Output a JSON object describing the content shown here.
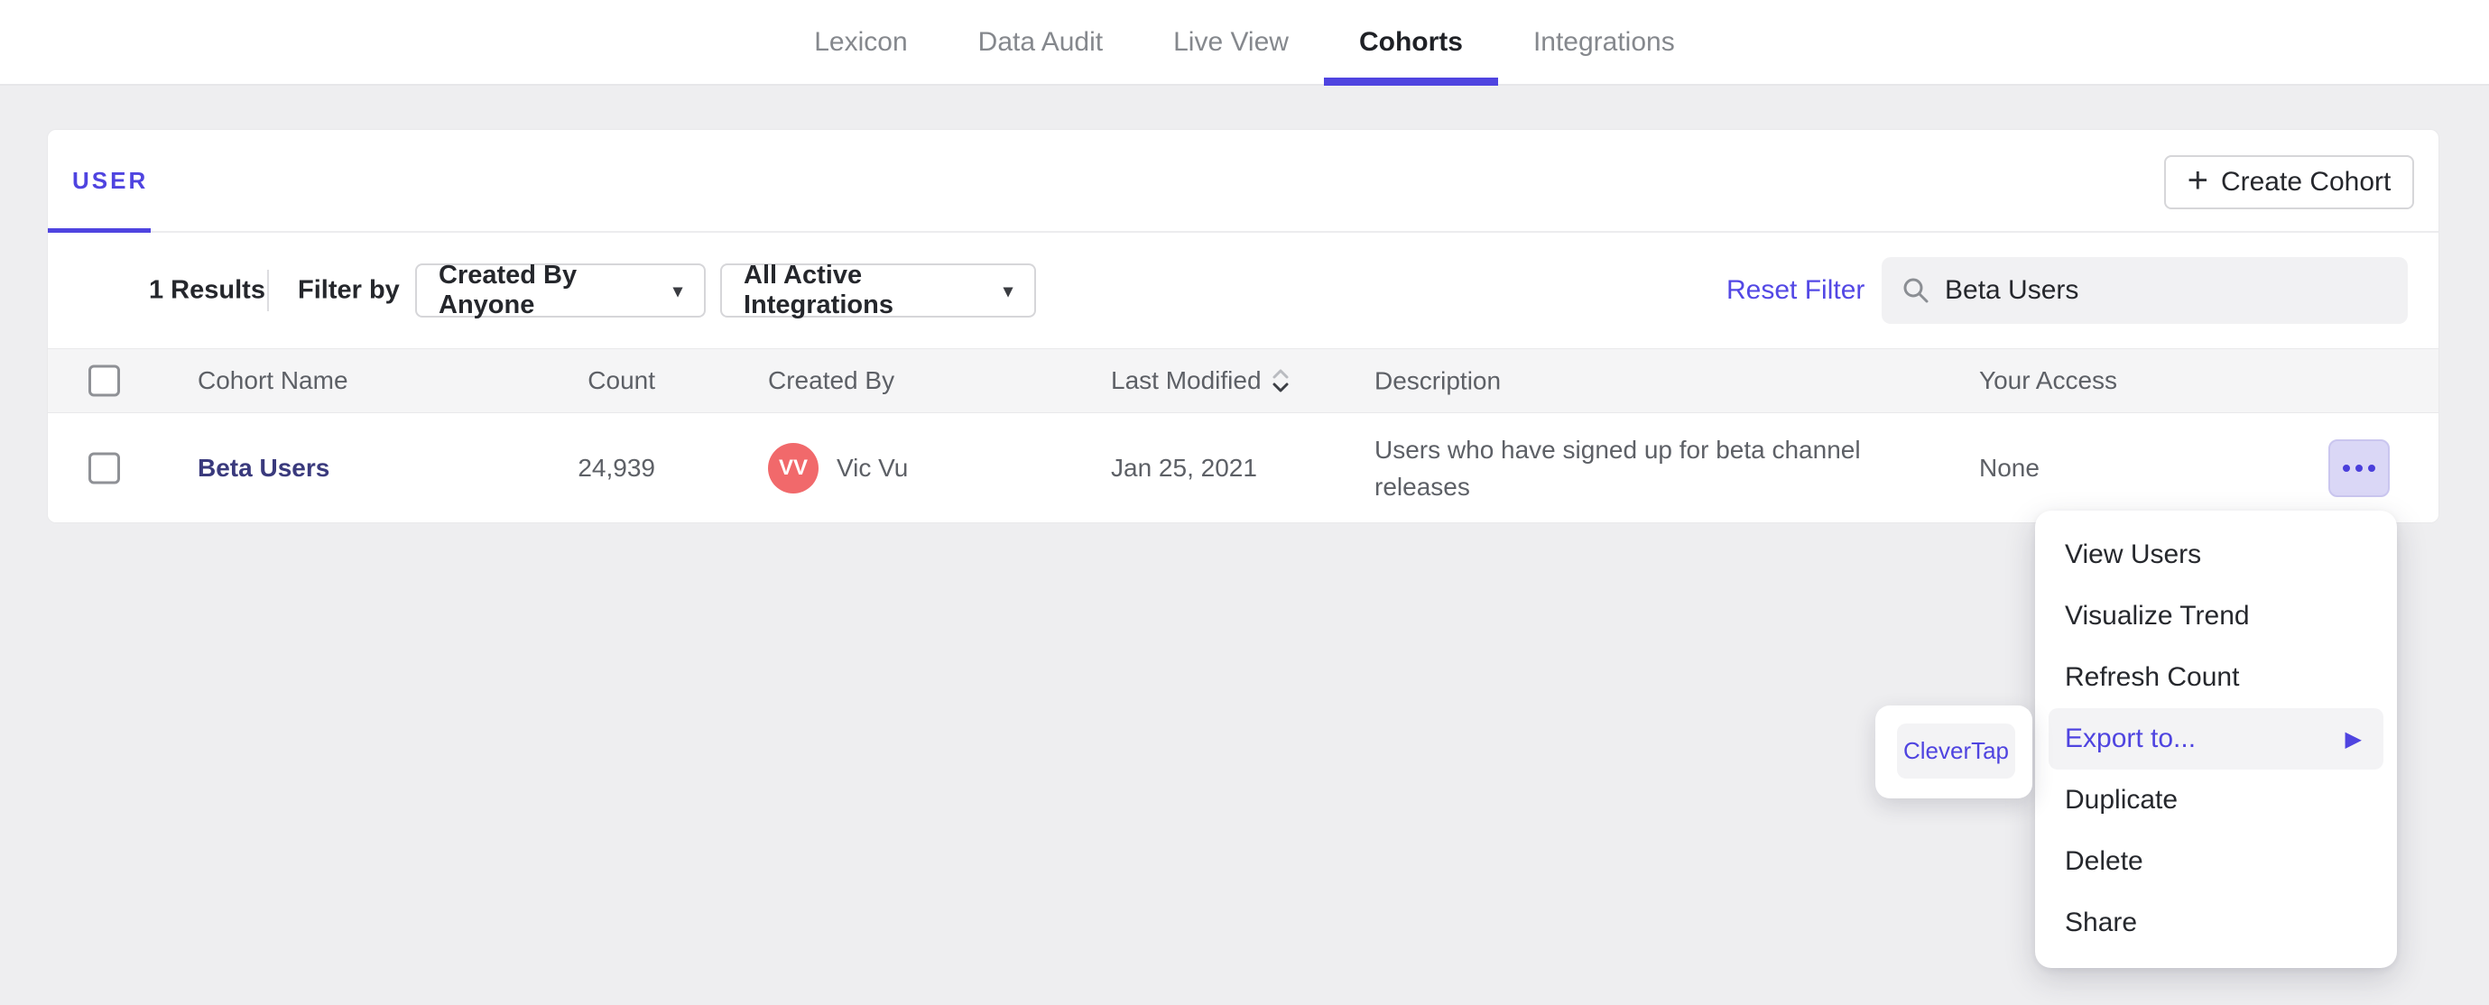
{
  "colors": {
    "accent_purple": "#4f44e0",
    "reset_link_purple": "#5348e5",
    "cohort_link_indigo": "#3a3a7d",
    "avatar_red": "#f1696b",
    "page_background": "#eeeef0",
    "table_header_background": "#f5f5f6",
    "search_background": "#f1f1f3",
    "menu_highlight_background": "#f3f3f5",
    "more_button_background": "#dad7f6"
  },
  "nav": {
    "tabs": [
      {
        "label": "Lexicon"
      },
      {
        "label": "Data Audit"
      },
      {
        "label": "Live View"
      },
      {
        "label": "Cohorts"
      },
      {
        "label": "Integrations"
      }
    ],
    "active_tab": "Cohorts"
  },
  "card": {
    "tab_label": "USER",
    "create_button_label": "Create Cohort",
    "plus_glyph": "+",
    "filter_bar": {
      "results_count": "1 Results",
      "filter_by_label": "Filter by",
      "created_by_filter": "Created By Anyone",
      "integrations_filter": "All Active Integrations",
      "caret_glyph": "▾",
      "reset_label": "Reset Filter",
      "search_value": "Beta Users"
    },
    "table": {
      "headers": {
        "name": "Cohort Name",
        "count": "Count",
        "created_by": "Created By",
        "last_modified": "Last Modified",
        "description": "Description",
        "access": "Your Access"
      },
      "row": {
        "name": "Beta Users",
        "count": "24,939",
        "avatar_initials": "VV",
        "created_by": "Vic Vu",
        "last_modified": "Jan 25, 2021",
        "description": "Users who have signed up for beta channel releases",
        "access": "None"
      }
    }
  },
  "context_menu": {
    "submenu_arrow_glyph": "▶",
    "items": [
      {
        "label": "View Users"
      },
      {
        "label": "Visualize Trend"
      },
      {
        "label": "Refresh Count"
      },
      {
        "label": "Export to...",
        "has_submenu": true
      },
      {
        "label": "Duplicate"
      },
      {
        "label": "Delete"
      },
      {
        "label": "Share"
      }
    ]
  },
  "export_submenu": {
    "items": [
      {
        "label": "CleverTap"
      }
    ]
  }
}
